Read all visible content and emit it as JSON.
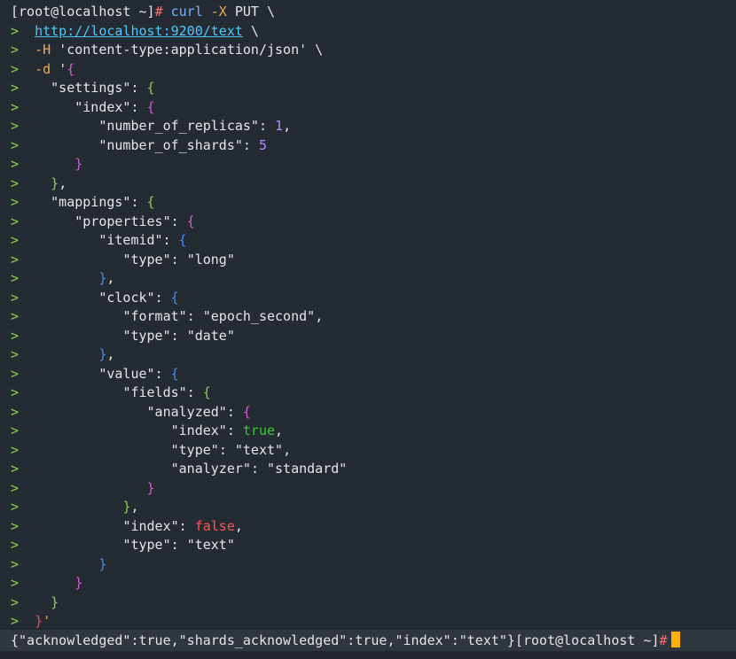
{
  "colors": {
    "default": "#e6e6e6",
    "prompt_marker": "#8bd14a",
    "hash": "#ff6e6e",
    "keyword": "#6fb7ff",
    "flag": "#f0a85a",
    "url": "#4fc8ff",
    "string": "#e6e6e6",
    "key": "#e6e6e6",
    "brace_green": "#8bd14a",
    "brace_magenta": "#d35ad6",
    "brace_blue": "#3f8cff",
    "number": "#b08cff",
    "true": "#33cc33",
    "false": "#ff5555",
    "red": "#ff4444"
  },
  "lines": [
    {
      "prompt": "",
      "tokens": [
        {
          "t": "[root@localhost ~]",
          "c": "default"
        },
        {
          "t": "# ",
          "c": "hash"
        },
        {
          "t": "curl ",
          "c": "keyword"
        },
        {
          "t": "-X ",
          "c": "flag"
        },
        {
          "t": "PUT \\",
          "c": "default"
        }
      ]
    },
    {
      "prompt": ">  ",
      "tokens": [
        {
          "t": "http://localhost:9200/text",
          "c": "url",
          "u": true
        },
        {
          "t": " \\",
          "c": "default"
        }
      ]
    },
    {
      "prompt": ">  ",
      "tokens": [
        {
          "t": "-H ",
          "c": "flag"
        },
        {
          "t": "'content-type:application/json'",
          "c": "string"
        },
        {
          "t": " \\",
          "c": "default"
        }
      ]
    },
    {
      "prompt": ">  ",
      "tokens": [
        {
          "t": "-d ",
          "c": "flag"
        },
        {
          "t": "'",
          "c": "string"
        },
        {
          "t": "{",
          "c": "brace_magenta"
        }
      ]
    },
    {
      "prompt": ">    ",
      "tokens": [
        {
          "t": "\"settings\"",
          "c": "key"
        },
        {
          "t": ": ",
          "c": "default"
        },
        {
          "t": "{",
          "c": "brace_green"
        }
      ]
    },
    {
      "prompt": ">       ",
      "tokens": [
        {
          "t": "\"index\"",
          "c": "key"
        },
        {
          "t": ": ",
          "c": "default"
        },
        {
          "t": "{",
          "c": "brace_magenta"
        }
      ]
    },
    {
      "prompt": ">          ",
      "tokens": [
        {
          "t": "\"number_of_replicas\"",
          "c": "key"
        },
        {
          "t": ": ",
          "c": "default"
        },
        {
          "t": "1",
          "c": "number"
        },
        {
          "t": ",",
          "c": "default"
        }
      ]
    },
    {
      "prompt": ">          ",
      "tokens": [
        {
          "t": "\"number_of_shards\"",
          "c": "key"
        },
        {
          "t": ": ",
          "c": "default"
        },
        {
          "t": "5",
          "c": "number"
        }
      ]
    },
    {
      "prompt": ">       ",
      "tokens": [
        {
          "t": "}",
          "c": "brace_magenta"
        }
      ]
    },
    {
      "prompt": ">    ",
      "tokens": [
        {
          "t": "}",
          "c": "brace_green"
        },
        {
          "t": ",",
          "c": "default"
        }
      ]
    },
    {
      "prompt": ">    ",
      "tokens": [
        {
          "t": "\"mappings\"",
          "c": "key"
        },
        {
          "t": ": ",
          "c": "default"
        },
        {
          "t": "{",
          "c": "brace_green"
        }
      ]
    },
    {
      "prompt": ">       ",
      "tokens": [
        {
          "t": "\"properties\"",
          "c": "key"
        },
        {
          "t": ": ",
          "c": "default"
        },
        {
          "t": "{",
          "c": "brace_magenta"
        }
      ]
    },
    {
      "prompt": ">          ",
      "tokens": [
        {
          "t": "\"itemid\"",
          "c": "key"
        },
        {
          "t": ": ",
          "c": "default"
        },
        {
          "t": "{",
          "c": "brace_blue"
        }
      ]
    },
    {
      "prompt": ">             ",
      "tokens": [
        {
          "t": "\"type\"",
          "c": "key"
        },
        {
          "t": ": ",
          "c": "default"
        },
        {
          "t": "\"long\"",
          "c": "string"
        }
      ]
    },
    {
      "prompt": ">          ",
      "tokens": [
        {
          "t": "}",
          "c": "brace_blue"
        },
        {
          "t": ",",
          "c": "default"
        }
      ]
    },
    {
      "prompt": ">          ",
      "tokens": [
        {
          "t": "\"clock\"",
          "c": "key"
        },
        {
          "t": ": ",
          "c": "default"
        },
        {
          "t": "{",
          "c": "brace_blue"
        }
      ]
    },
    {
      "prompt": ">             ",
      "tokens": [
        {
          "t": "\"format\"",
          "c": "key"
        },
        {
          "t": ": ",
          "c": "default"
        },
        {
          "t": "\"epoch_second\"",
          "c": "string"
        },
        {
          "t": ",",
          "c": "default"
        }
      ]
    },
    {
      "prompt": ">             ",
      "tokens": [
        {
          "t": "\"type\"",
          "c": "key"
        },
        {
          "t": ": ",
          "c": "default"
        },
        {
          "t": "\"date\"",
          "c": "string"
        }
      ]
    },
    {
      "prompt": ">          ",
      "tokens": [
        {
          "t": "}",
          "c": "brace_blue"
        },
        {
          "t": ",",
          "c": "default"
        }
      ]
    },
    {
      "prompt": ">          ",
      "tokens": [
        {
          "t": "\"value\"",
          "c": "key"
        },
        {
          "t": ": ",
          "c": "default"
        },
        {
          "t": "{",
          "c": "brace_blue"
        }
      ]
    },
    {
      "prompt": ">             ",
      "tokens": [
        {
          "t": "\"fields\"",
          "c": "key"
        },
        {
          "t": ": ",
          "c": "default"
        },
        {
          "t": "{",
          "c": "brace_green"
        }
      ]
    },
    {
      "prompt": ">                ",
      "tokens": [
        {
          "t": "\"analyzed\"",
          "c": "key"
        },
        {
          "t": ": ",
          "c": "default"
        },
        {
          "t": "{",
          "c": "brace_magenta"
        }
      ]
    },
    {
      "prompt": ">                   ",
      "tokens": [
        {
          "t": "\"index\"",
          "c": "key"
        },
        {
          "t": ": ",
          "c": "default"
        },
        {
          "t": "true",
          "c": "true"
        },
        {
          "t": ",",
          "c": "default"
        }
      ]
    },
    {
      "prompt": ">                   ",
      "tokens": [
        {
          "t": "\"type\"",
          "c": "key"
        },
        {
          "t": ": ",
          "c": "default"
        },
        {
          "t": "\"text\"",
          "c": "string"
        },
        {
          "t": ",",
          "c": "default"
        }
      ]
    },
    {
      "prompt": ">                   ",
      "tokens": [
        {
          "t": "\"analyzer\"",
          "c": "key"
        },
        {
          "t": ": ",
          "c": "default"
        },
        {
          "t": "\"standard\"",
          "c": "string"
        }
      ]
    },
    {
      "prompt": ">                ",
      "tokens": [
        {
          "t": "}",
          "c": "brace_magenta"
        }
      ]
    },
    {
      "prompt": ">             ",
      "tokens": [
        {
          "t": "}",
          "c": "brace_green"
        },
        {
          "t": ",",
          "c": "default"
        }
      ]
    },
    {
      "prompt": ">             ",
      "tokens": [
        {
          "t": "\"index\"",
          "c": "key"
        },
        {
          "t": ": ",
          "c": "default"
        },
        {
          "t": "false",
          "c": "false"
        },
        {
          "t": ",",
          "c": "default"
        }
      ]
    },
    {
      "prompt": ">             ",
      "tokens": [
        {
          "t": "\"type\"",
          "c": "key"
        },
        {
          "t": ": ",
          "c": "default"
        },
        {
          "t": "\"text\"",
          "c": "string"
        }
      ]
    },
    {
      "prompt": ">          ",
      "tokens": [
        {
          "t": "}",
          "c": "brace_blue"
        }
      ]
    },
    {
      "prompt": ">       ",
      "tokens": [
        {
          "t": "}",
          "c": "brace_magenta"
        }
      ]
    },
    {
      "prompt": ">    ",
      "tokens": [
        {
          "t": "}",
          "c": "brace_green"
        }
      ]
    },
    {
      "prompt": ">  ",
      "tokens": [
        {
          "t": "}",
          "c": "red"
        },
        {
          "t": "'",
          "c": "flag"
        }
      ]
    }
  ],
  "response_line": {
    "tokens": [
      {
        "t": "{\"acknowledged\":true,\"shards_acknowledged\":true,\"index\":\"text\"}",
        "c": "default"
      },
      {
        "t": "[root@localhost ~]",
        "c": "default"
      },
      {
        "t": "#",
        "c": "hash"
      }
    ]
  }
}
